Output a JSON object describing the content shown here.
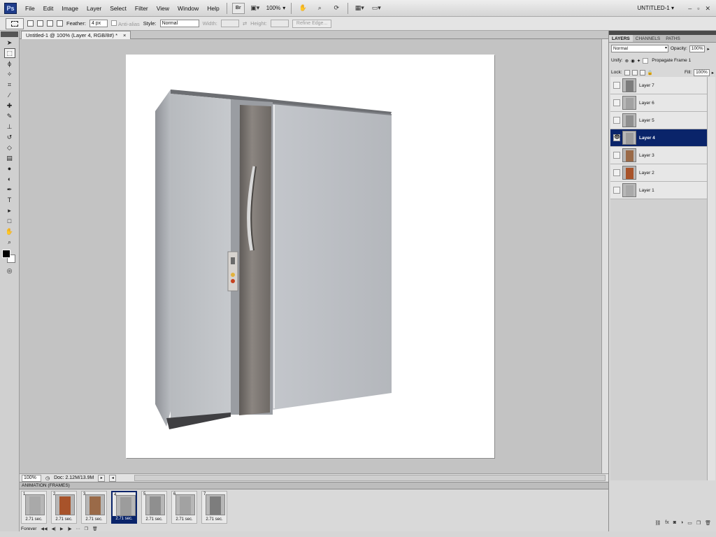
{
  "menubar": {
    "logo": "Ps",
    "items": [
      "File",
      "Edit",
      "Image",
      "Layer",
      "Select",
      "Filter",
      "View",
      "Window",
      "Help"
    ],
    "bridge_label": "Br",
    "zoom": "100%",
    "workspace": "UNTITLED-1",
    "window_controls": {
      "minimize": "–",
      "restore": "▫",
      "close": "✕"
    }
  },
  "options": {
    "feather_label": "Feather:",
    "feather_value": "4 px",
    "antialias_label": "Anti-alias",
    "style_label": "Style:",
    "style_value": "Normal",
    "width_label": "Width:",
    "height_label": "Height:",
    "refine_label": "Refine Edge..."
  },
  "document": {
    "tab_title": "Untitled-1 @ 100% (Layer 4, RGB/8#) *",
    "tab_close": "×"
  },
  "status": {
    "zoom": "100%",
    "doc_info": "Doc: 2.12M/13.9M"
  },
  "animation": {
    "title": "ANIMATION (FRAMES)",
    "frames": [
      {
        "num": "1",
        "delay": "2.71 sec.",
        "thumb_color": "#a9a9a9"
      },
      {
        "num": "2",
        "delay": "2.71 sec.",
        "thumb_color": "#a8532a"
      },
      {
        "num": "3",
        "delay": "2.71 sec.",
        "thumb_color": "#9a6a48"
      },
      {
        "num": "4",
        "delay": "2.71 sec.",
        "thumb_color": "#9c9c9c"
      },
      {
        "num": "5",
        "delay": "2.71 sec.",
        "thumb_color": "#8f8f8f"
      },
      {
        "num": "6",
        "delay": "2.71 sec.",
        "thumb_color": "#a2a2a2"
      },
      {
        "num": "7",
        "delay": "2.71 sec.",
        "thumb_color": "#7d7d7d"
      }
    ],
    "loop": "Forever"
  },
  "layers_panel": {
    "tabs": [
      "LAYERS",
      "CHANNELS",
      "PATHS"
    ],
    "blend_mode": "Normal",
    "opacity_label": "Opacity:",
    "opacity_value": "100%",
    "unify_label": "Unify:",
    "propagate_label": "Propagate Frame 1",
    "lock_label": "Lock:",
    "fill_label": "Fill:",
    "fill_value": "100%",
    "layers": [
      {
        "name": "Layer 7",
        "visible": false,
        "active": false,
        "thumb_color": "#7d7d7d"
      },
      {
        "name": "Layer 6",
        "visible": false,
        "active": false,
        "thumb_color": "#a2a2a2"
      },
      {
        "name": "Layer 5",
        "visible": false,
        "active": false,
        "thumb_color": "#8f8f8f"
      },
      {
        "name": "Layer 4",
        "visible": true,
        "active": true,
        "thumb_color": "#9c9c9c"
      },
      {
        "name": "Layer 3",
        "visible": false,
        "active": false,
        "thumb_color": "#9a6a48"
      },
      {
        "name": "Layer 2",
        "visible": false,
        "active": false,
        "thumb_color": "#a8532a"
      },
      {
        "name": "Layer 1",
        "visible": false,
        "active": false,
        "thumb_color": "#a9a9a9"
      }
    ]
  },
  "tools": [
    "move-tool",
    "rect-marquee-tool",
    "lasso-tool",
    "magic-wand-tool",
    "crop-tool",
    "eyedropper-tool",
    "healing-brush-tool",
    "brush-tool",
    "clone-stamp-tool",
    "history-brush-tool",
    "eraser-tool",
    "gradient-tool",
    "blur-tool",
    "dodge-tool",
    "pen-tool",
    "type-tool",
    "path-select-tool",
    "rectangle-tool",
    "hand-tool",
    "zoom-tool"
  ],
  "accent_colors": {
    "selection": "#0a246a",
    "workspace": "#c3c3c3"
  }
}
